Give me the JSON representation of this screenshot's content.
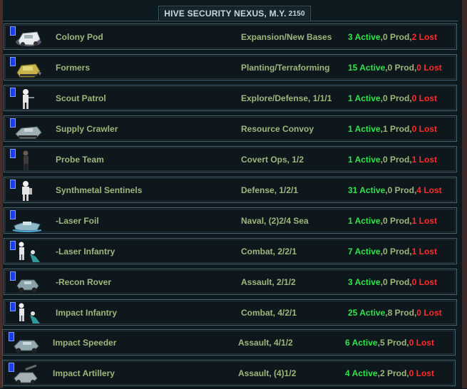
{
  "window": {
    "title": "HIVE SECURITY NEXUS,  M.Y.",
    "year": "2150"
  },
  "units": [
    {
      "name": "Colony Pod",
      "role": "Expansion/New Bases",
      "active": "3 Active",
      "prod": "0 Prod",
      "lost": "2 Lost",
      "icon": "colony-pod-icon"
    },
    {
      "name": "Formers",
      "role": "Planting/Terraforming",
      "active": "15 Active",
      "prod": "0 Prod",
      "lost": "0 Lost",
      "icon": "formers-icon"
    },
    {
      "name": "Scout Patrol",
      "role": "Explore/Defense, 1/1/1",
      "active": "1 Active",
      "prod": "0 Prod",
      "lost": "0 Lost",
      "icon": "scout-patrol-icon"
    },
    {
      "name": "Supply Crawler",
      "role": "Resource Convoy",
      "active": "1 Active",
      "prod": "1 Prod",
      "lost": "0 Lost",
      "icon": "supply-crawler-icon"
    },
    {
      "name": "Probe Team",
      "role": "Covert Ops, 1/2",
      "active": "1 Active",
      "prod": "0 Prod",
      "lost": "1 Lost",
      "icon": "probe-team-icon"
    },
    {
      "name": "Synthmetal Sentinels",
      "role": "Defense, 1/2/1",
      "active": "31 Active",
      "prod": "0 Prod",
      "lost": "4 Lost",
      "icon": "sentinel-icon"
    },
    {
      "name": "-Laser Foil",
      "role": "Naval, (2)2/4 Sea",
      "active": "1 Active",
      "prod": "0 Prod",
      "lost": "1 Lost",
      "icon": "foil-icon"
    },
    {
      "name": "-Laser Infantry",
      "role": "Combat, 2/2/1",
      "active": "7 Active",
      "prod": "0 Prod",
      "lost": "1 Lost",
      "icon": "infantry-icon"
    },
    {
      "name": "-Recon Rover",
      "role": "Assault, 2/1/2",
      "active": "3 Active",
      "prod": "0 Prod",
      "lost": "0 Lost",
      "icon": "rover-icon"
    },
    {
      "name": "Impact Infantry",
      "role": "Combat, 4/2/1",
      "active": "25 Active",
      "prod": "8 Prod",
      "lost": "0 Lost",
      "icon": "infantry-icon"
    },
    {
      "name": "Impact Speeder",
      "role": "Assault, 4/1/2",
      "active": "6 Active",
      "prod": "5 Prod",
      "lost": "0 Lost",
      "icon": "speeder-icon"
    },
    {
      "name": "Impact Artillery",
      "role": "Assault, (4)1/2",
      "active": "4 Active",
      "prod": "2 Prod",
      "lost": "0 Lost",
      "icon": "artillery-icon"
    }
  ]
}
